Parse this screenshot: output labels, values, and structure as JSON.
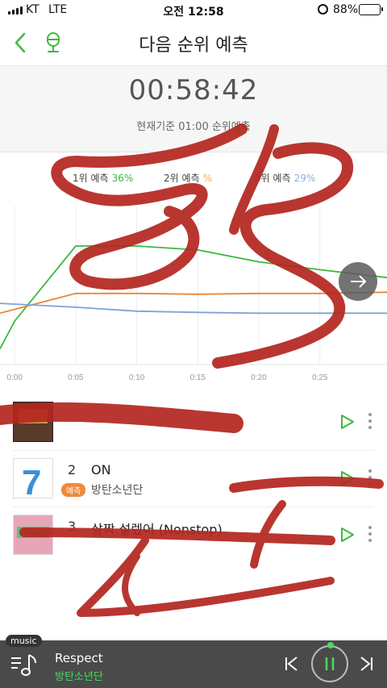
{
  "status": {
    "carrier": "KT",
    "network": "LTE",
    "time": "오전 12:58",
    "battery": "88%"
  },
  "nav": {
    "title": "다음 순위 예측",
    "back_icon": "chevron-left-icon",
    "mic_icon": "microphone-icon"
  },
  "timer": {
    "countdown": "00:58:42",
    "basis": "현재기준 01:00 순위예측"
  },
  "legend": [
    {
      "label": "1위 예측",
      "pct": "36%",
      "color": "#3cba3c"
    },
    {
      "label": "2위 예측",
      "pct": "%",
      "color": "#f0ac4a"
    },
    {
      "label": "3위 예측",
      "pct": "29%",
      "color": "#8fb0e0"
    }
  ],
  "chart_data": {
    "type": "line",
    "x": [
      "0:00",
      "0:05",
      "0:10",
      "0:15",
      "0:20",
      "0:25"
    ],
    "xlim": [
      -1.2,
      30.5
    ],
    "series": [
      {
        "color": "#3cba3c",
        "x": [
          -1.2,
          0,
          5,
          10,
          15,
          20,
          25,
          30.5
        ],
        "values": [
          34,
          41,
          60,
          60,
          59,
          56,
          54,
          52
        ]
      },
      {
        "color": "#e8873a",
        "x": [
          -1.2,
          5,
          10,
          15,
          20,
          25,
          30.5
        ],
        "values": [
          43,
          48,
          48,
          47.8,
          48,
          48,
          48.3
        ]
      },
      {
        "color": "#7aa5d8",
        "x": [
          -1.2,
          5,
          10,
          15,
          20,
          25,
          30.5
        ],
        "values": [
          45.5,
          44.5,
          43.5,
          43.2,
          43,
          43,
          43
        ]
      }
    ],
    "grid": true
  },
  "songs": [
    {
      "rank": "",
      "title": "",
      "badge": "",
      "artist": ""
    },
    {
      "rank": "2",
      "title": "ON",
      "badge": "예측",
      "artist": "방탄소년단"
    },
    {
      "rank": "3",
      "title": "살짝 설렜어 (Nonstop)",
      "badge": "",
      "artist": ""
    }
  ],
  "player": {
    "tag": "music",
    "track": "Respect",
    "artist": "방탄소년단"
  },
  "colors": {
    "accent": "#3cba3c",
    "player_bg": "#4a4a4a",
    "scribble": "#b3261e"
  }
}
